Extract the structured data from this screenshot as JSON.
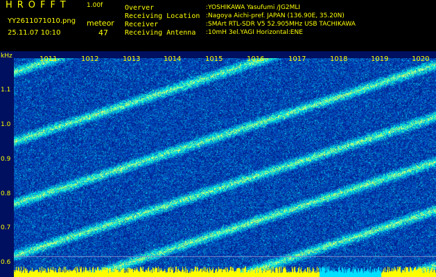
{
  "header": {
    "app_title": "HROFFT",
    "version": "1.00f",
    "file_name": "YY2611071010.png",
    "timestamp": "25.11.07 10:10",
    "meteor_label": "meteor",
    "meteor_count": "47",
    "info": [
      {
        "key": "Overver",
        "value": ":YOSHIKAWA Yasufumi /JG2MLI"
      },
      {
        "key": "Receiving Location",
        "value": ":Nagoya Aichi-pref. JAPAN (136.90E, 35.20N)"
      },
      {
        "key": "Receiver",
        "value": ":SMArt RTL-SDR V5 52.905MHz USB TACHIKAWA"
      },
      {
        "key": "Receiving Antenna",
        "value": ":10mH 3el.YAGI Horizontal:ENE"
      }
    ]
  },
  "spectrogram": {
    "freq_unit": "kHz",
    "freq_ticks": [
      "1.1",
      "1.0",
      "0.9",
      "0.8",
      "0.7",
      "0.6"
    ],
    "time_ticks": [
      "1011",
      "1012",
      "1013",
      "1014",
      "1015",
      "1016",
      "1017",
      "1018",
      "1019",
      "1020"
    ],
    "colors": {
      "background": "#000080",
      "label": "#ffff00",
      "signal": "#00ffff",
      "bar": "#ffff00"
    }
  }
}
